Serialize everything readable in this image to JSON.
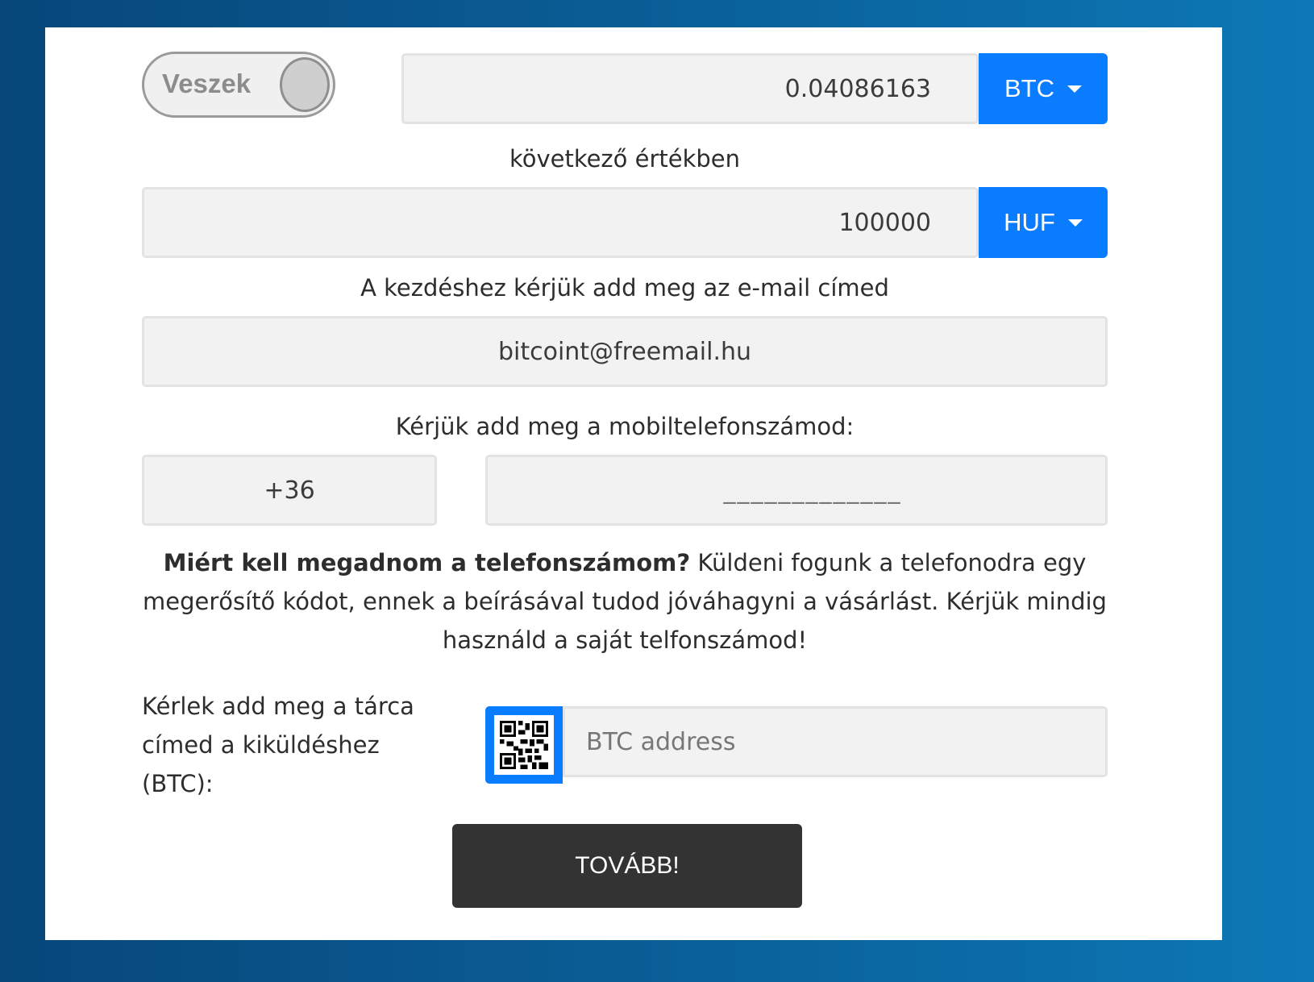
{
  "toggle": {
    "label": "Veszek"
  },
  "crypto": {
    "amount": "0.04086163",
    "currency": "BTC"
  },
  "value_label": "következő értékben",
  "fiat": {
    "amount": "100000",
    "currency": "HUF"
  },
  "email": {
    "label": "A kezdéshez kérjük add meg az e-mail címed",
    "value": "bitcoint@freemail.hu"
  },
  "phone": {
    "label": "Kérjük add meg a mobiltelefonszámod:",
    "prefix": "+36",
    "mask": "_____________"
  },
  "info": {
    "bold": "Miért kell megadnom a telefonszámom?",
    "text": " Küldeni fogunk a telefonodra egy megerősítő kódot, ennek a beírásával tudod jóváhagyni a vásárlást. Kérjük mindig használd a saját telfonszámod!"
  },
  "wallet": {
    "label": "Kérlek add meg a tárca címed a kiküldéshez (BTC):",
    "placeholder": "BTC address",
    "qr_icon": "qr-code-icon"
  },
  "submit": {
    "label": "TOVÁBB!"
  },
  "colors": {
    "accent": "#0a7cff",
    "dark_button": "#333333",
    "field_bg": "#f2f2f2"
  }
}
